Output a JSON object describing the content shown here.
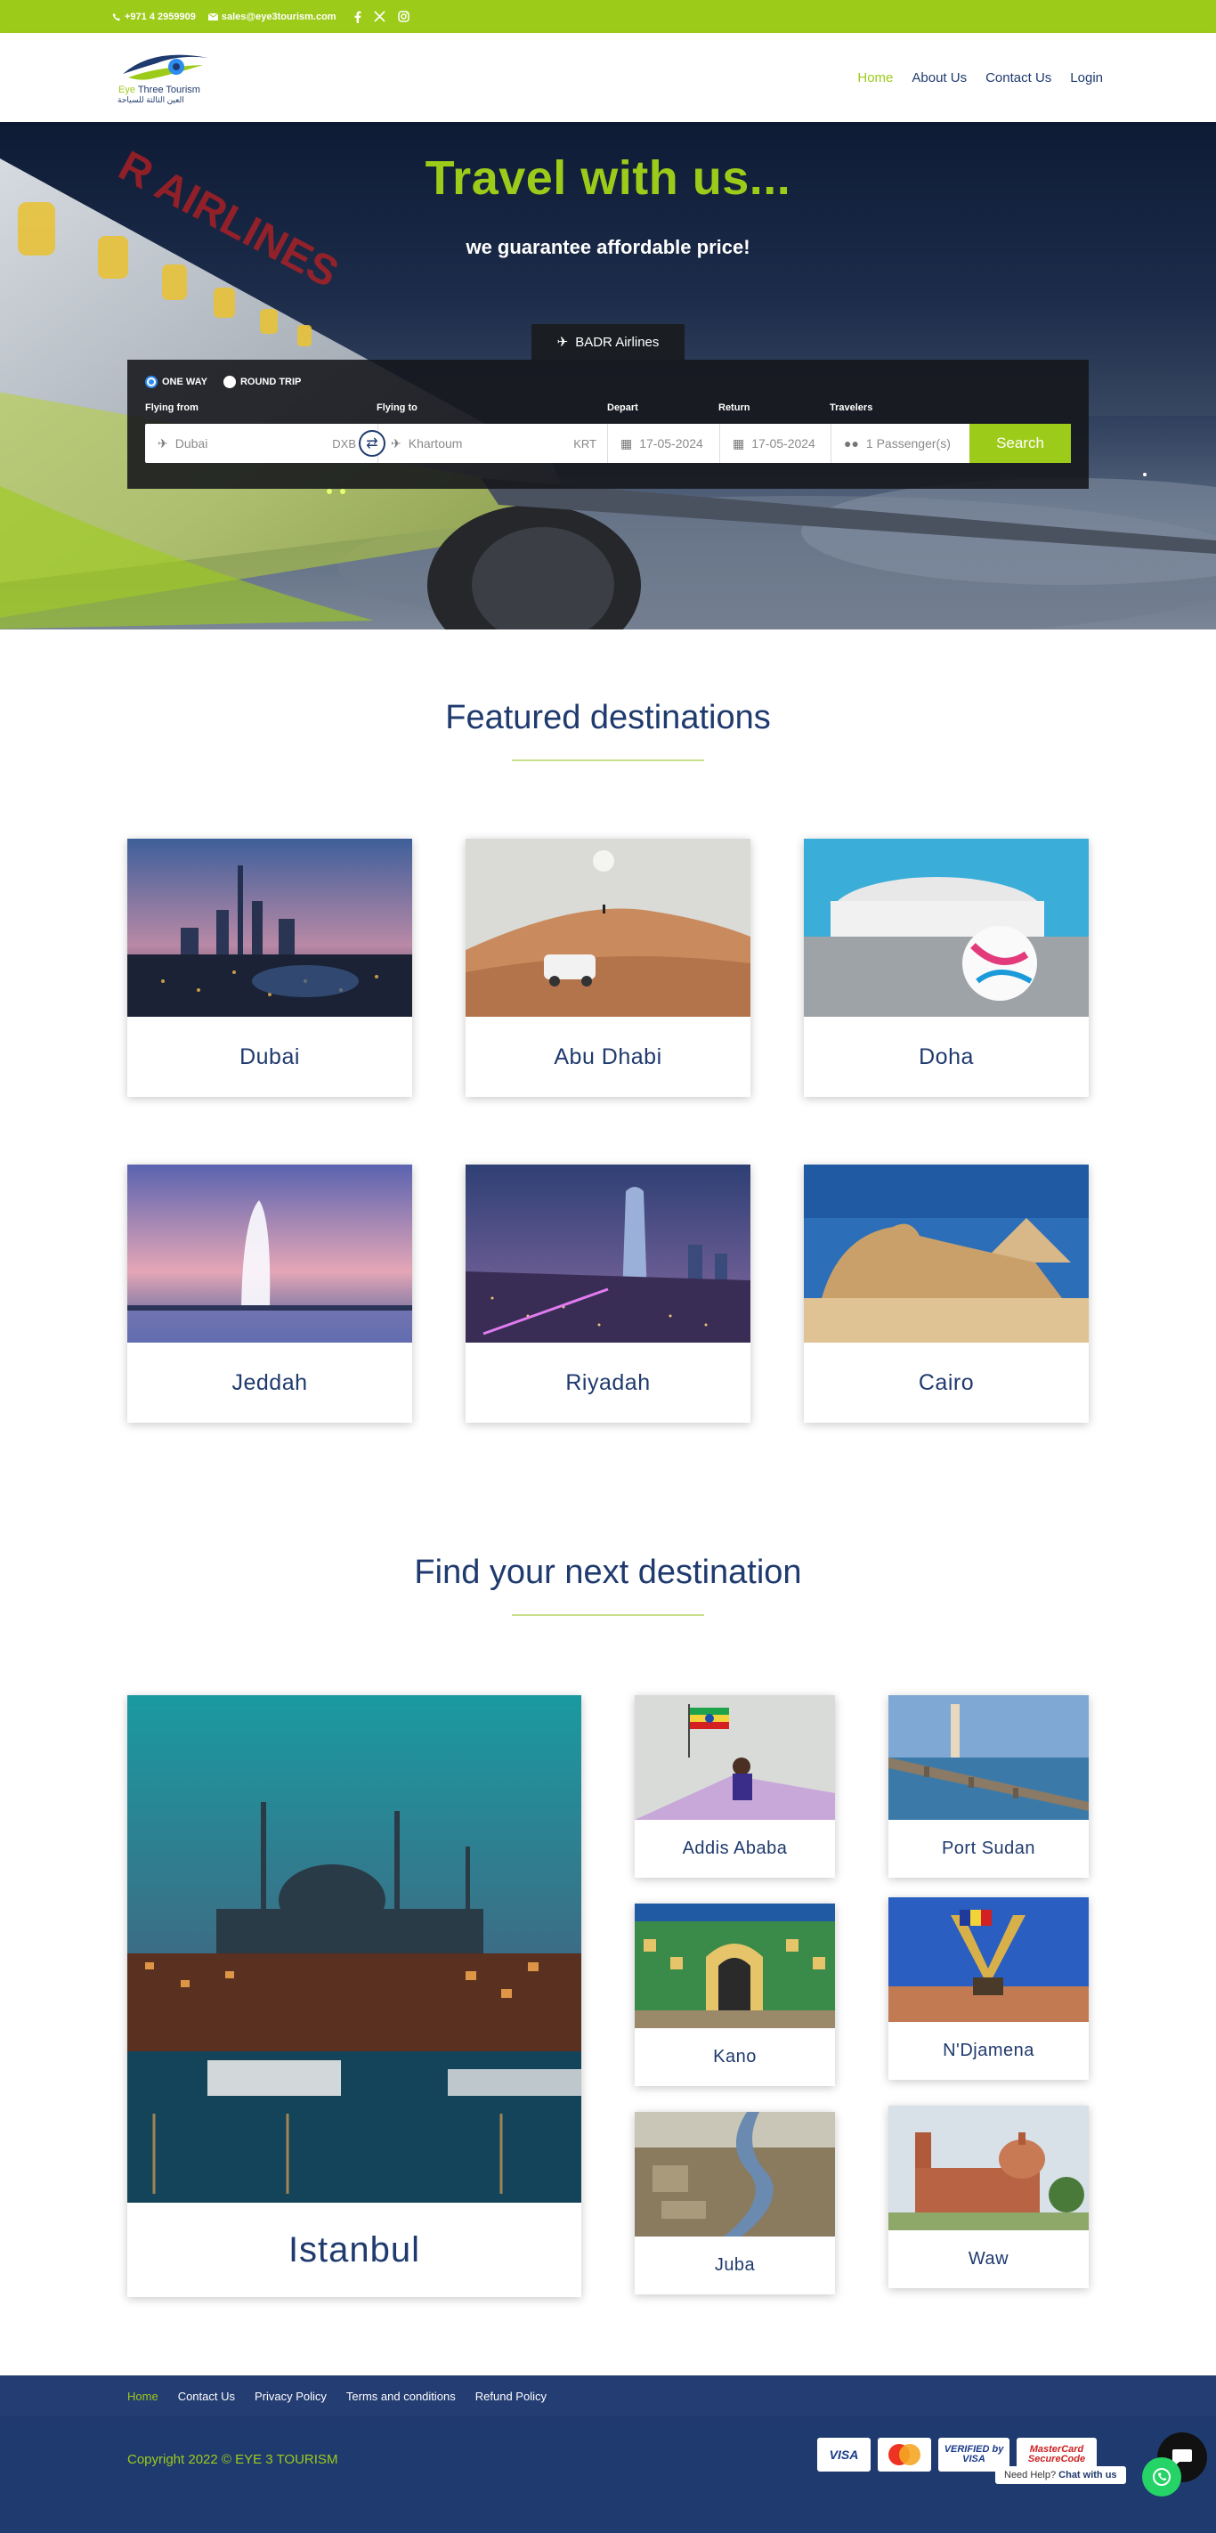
{
  "topbar": {
    "phone": "+971 4 2959909",
    "email": "sales@eye3tourism.com",
    "social": [
      "facebook-icon",
      "x-icon",
      "instagram-icon"
    ]
  },
  "logo": {
    "brand_a": "Eye",
    "brand_b": " Three Tourism",
    "arabic": "العين الثالثة للسياحة"
  },
  "nav": {
    "items": [
      "Home",
      "About Us",
      "Contact Us",
      "Login"
    ],
    "active": "Home"
  },
  "hero": {
    "title": "Travel with us...",
    "subtitle": "we guarantee affordable price!",
    "tab": "BADR Airlines"
  },
  "search": {
    "one_way": "ONE WAY",
    "round_trip": "ROUND TRIP",
    "selected": "ONE WAY",
    "label_from": "Flying from",
    "label_to": "Flying to",
    "label_depart": "Depart",
    "label_return": "Return",
    "label_travelers": "Travelers",
    "from": "Dubai",
    "from_code": "DXB",
    "to": "Khartoum",
    "to_code": "KRT",
    "depart": "17-05-2024",
    "return": "17-05-2024",
    "travelers": "1 Passenger(s)",
    "button": "Search"
  },
  "featured": {
    "title": "Featured destinations",
    "items": [
      "Dubai",
      "Abu Dhabi",
      "Doha",
      "Jeddah",
      "Riyadah",
      "Cairo"
    ]
  },
  "next": {
    "title": "Find your next destination",
    "big": "Istanbul",
    "items": [
      "Addis Ababa",
      "Port Sudan",
      "Kano",
      "N'Djamena",
      "Juba",
      "Waw"
    ]
  },
  "footer": {
    "links": [
      "Home",
      "Contact Us",
      "Privacy Policy",
      "Terms and conditions",
      "Refund Policy"
    ],
    "copyright": "Copyright 2022 © EYE 3 TOURISM",
    "cards": [
      "VISA",
      "MasterCard",
      "VERIFIED by VISA",
      "MasterCard SecureCode"
    ],
    "help_a": "Need Help?",
    "help_b": "Chat with us"
  },
  "colors": {
    "accent": "#9dcb19",
    "navy": "#1f3a6e",
    "footer_nav": "#243d73"
  }
}
